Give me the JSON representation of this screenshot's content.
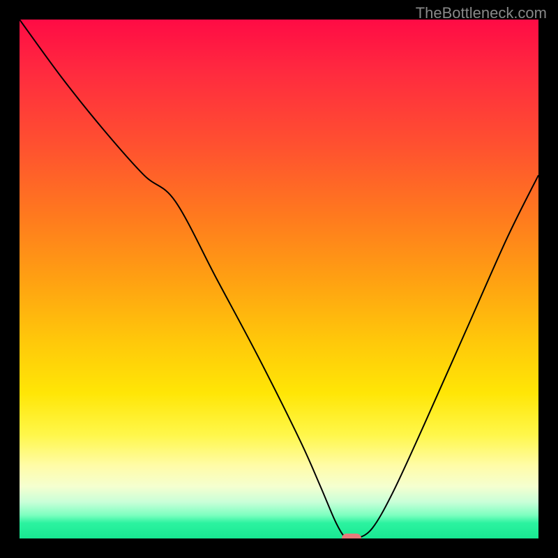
{
  "watermark": "TheBottleneck.com",
  "chart_data": {
    "type": "line",
    "title": "",
    "xlabel": "",
    "ylabel": "",
    "xlim": [
      0,
      100
    ],
    "ylim": [
      0,
      100
    ],
    "series": [
      {
        "name": "curve",
        "x": [
          0,
          8,
          16,
          24,
          30,
          38,
          46,
          54,
          58,
          61,
          63,
          65,
          68,
          72,
          78,
          86,
          94,
          100
        ],
        "y": [
          100,
          89,
          79,
          70,
          65,
          50,
          35,
          19,
          10,
          3,
          0,
          0,
          2,
          9,
          22,
          40,
          58,
          70
        ]
      }
    ],
    "marker": {
      "x": 64,
      "y": 0,
      "color": "#e77b7b"
    },
    "stroke_color": "#000000",
    "stroke_width": 2
  }
}
